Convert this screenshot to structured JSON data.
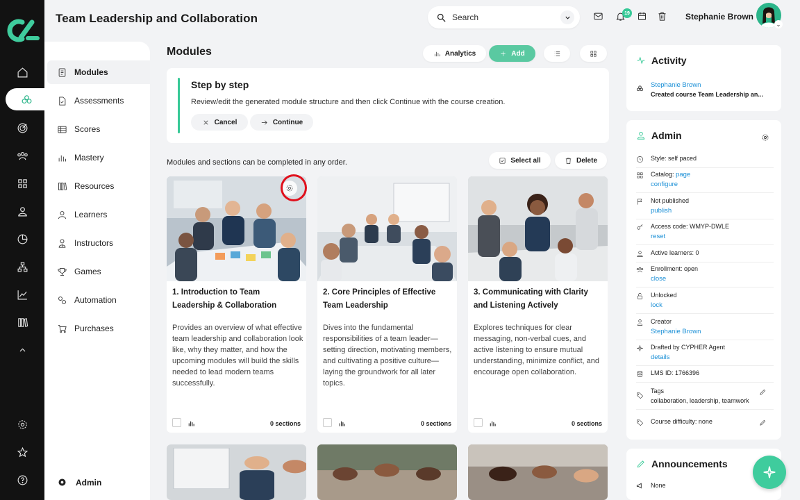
{
  "header": {
    "title": "Team Leadership and Collaboration",
    "search_placeholder": "Search",
    "notification_count": "19",
    "user_name": "Stephanie Brown"
  },
  "subnav": {
    "items": [
      {
        "label": "Modules"
      },
      {
        "label": "Assessments"
      },
      {
        "label": "Scores"
      },
      {
        "label": "Mastery"
      },
      {
        "label": "Resources"
      },
      {
        "label": "Learners"
      },
      {
        "label": "Instructors"
      },
      {
        "label": "Games"
      },
      {
        "label": "Automation"
      },
      {
        "label": "Purchases"
      }
    ],
    "admin_label": "Admin"
  },
  "main": {
    "title": "Modules",
    "analytics_label": "Analytics",
    "add_label": "Add",
    "step": {
      "title": "Step by step",
      "text": "Review/edit the generated module structure and then click Continue with the course creation.",
      "cancel_label": "Cancel",
      "continue_label": "Continue"
    },
    "note": "Modules and sections can be completed in any order.",
    "select_all_label": "Select all",
    "delete_label": "Delete",
    "cards": [
      {
        "title": "1. Introduction to Team Leadership & Collaboration",
        "desc": "Provides an overview of what effective team leadership and collaboration look like, why they matter, and how the upcoming modules will build the skills needed to lead modern teams successfully.",
        "sections": "0 sections"
      },
      {
        "title": "2. Core Principles of Effective Team Leadership",
        "desc": "Dives into the fundamental responsibilities of a team leader—setting direction, motivating members, and cultivating a positive culture—laying the groundwork for all later topics.",
        "sections": "0 sections"
      },
      {
        "title": "3. Communicating with Clarity and Listening Actively",
        "desc": "Explores techniques for clear messaging, non-verbal cues, and active listening to ensure mutual understanding, minimize conflict, and encourage open collaboration.",
        "sections": "0 sections"
      }
    ]
  },
  "activity": {
    "title": "Activity",
    "user": "Stephanie Brown",
    "text": "Created course Team Leadership an..."
  },
  "admin": {
    "title": "Admin",
    "style": "Style: self paced",
    "catalog": "Catalog:",
    "catalog_link1": "page",
    "catalog_link2": "configure",
    "published": "Not published",
    "published_link": "publish",
    "access": "Access code: WMYP-DWLE",
    "access_link": "reset",
    "learners": "Active learners: 0",
    "enrollment": "Enrollment: open",
    "enrollment_link": "close",
    "lock": "Unlocked",
    "lock_link": "lock",
    "creator": "Creator",
    "creator_link": "Stephanie Brown",
    "drafted": "Drafted by CYPHER Agent",
    "drafted_link": "details",
    "lms": "LMS ID: 1766396",
    "tags": "Tags",
    "tags_value": "collaboration, leadership, teamwork",
    "difficulty": "Course difficulty: none"
  },
  "announcements": {
    "title": "Announcements",
    "none": "None"
  },
  "colors": {
    "accent": "#37c997",
    "link": "#1a8fd6",
    "rail": "#121212",
    "highlight_ring": "#e0101c"
  }
}
